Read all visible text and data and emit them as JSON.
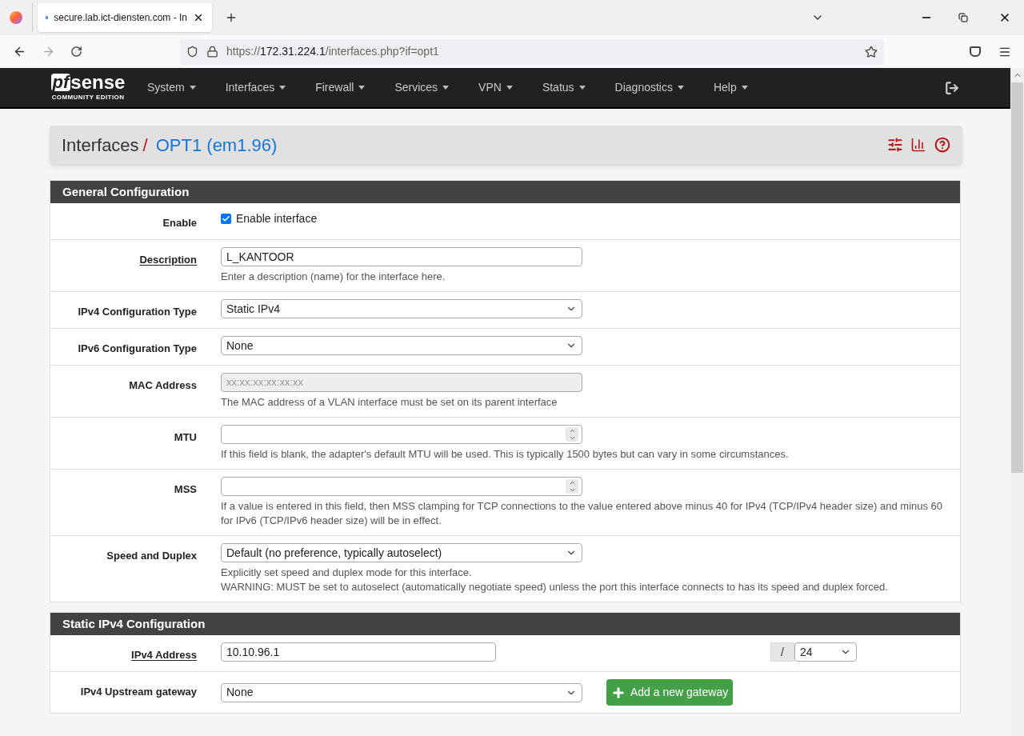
{
  "browser": {
    "tab_title": "secure.lab.ict-diensten.com - In",
    "url_scheme": "https://",
    "url_host": "172.31.224.1",
    "url_path": "/interfaces.php?if=opt1"
  },
  "navbar": {
    "logo_mark": "pf",
    "logo_word": "sense",
    "logo_sub": "COMMUNITY EDITION",
    "menus": [
      "System",
      "Interfaces",
      "Firewall",
      "Services",
      "VPN",
      "Status",
      "Diagnostics",
      "Help"
    ]
  },
  "page_title": {
    "crumbs": [
      "Interfaces",
      "OPT1 (em1.96)"
    ],
    "separator": "/"
  },
  "sections": [
    {
      "title": "General Configuration",
      "rows": [
        {
          "kind": "checkbox",
          "label": "Enable",
          "link": false,
          "checked": true,
          "text": "Enable interface",
          "help": []
        },
        {
          "kind": "text",
          "label": "Description",
          "link": true,
          "value": "L_KANTOOR",
          "help": [
            "Enter a description (name) for the interface here."
          ]
        },
        {
          "kind": "select",
          "label": "IPv4 Configuration Type",
          "link": false,
          "value": "Static IPv4",
          "help": []
        },
        {
          "kind": "select",
          "label": "IPv6 Configuration Type",
          "link": false,
          "value": "None",
          "help": []
        },
        {
          "kind": "text",
          "label": "MAC Address",
          "link": false,
          "disabled": true,
          "placeholder": "xx:xx:xx:xx:xx:xx",
          "help": [
            "The MAC address of a VLAN interface must be set on its parent interface"
          ]
        },
        {
          "kind": "number",
          "label": "MTU",
          "link": false,
          "help": [
            "If this field is blank, the adapter's default MTU will be used. This is typically 1500 bytes but can vary in some circumstances."
          ]
        },
        {
          "kind": "number",
          "label": "MSS",
          "link": false,
          "help": [
            "If a value is entered in this field, then MSS clamping for TCP connections to the value entered above minus 40 for IPv4 (TCP/IPv4 header size) and minus 60 for IPv6 (TCP/IPv6 header size) will be in effect."
          ]
        },
        {
          "kind": "select",
          "label": "Speed and Duplex",
          "link": false,
          "value": "Default (no preference, typically autoselect)",
          "help": [
            "Explicitly set speed and duplex mode for this interface.",
            "WARNING: MUST be set to autoselect (automatically negotiate speed) unless the port this interface connects to has its speed and duplex forced."
          ]
        }
      ]
    },
    {
      "title": "Static IPv4 Configuration",
      "rows": [
        {
          "kind": "address",
          "label": "IPv4 Address",
          "link": true,
          "value": "10.10.96.1",
          "mask_separator": "/",
          "mask": "24",
          "help": []
        },
        {
          "kind": "select_button",
          "label": "IPv4 Upstream gateway",
          "link": false,
          "value": "None",
          "button": "Add a new gateway",
          "help": []
        }
      ]
    }
  ]
}
